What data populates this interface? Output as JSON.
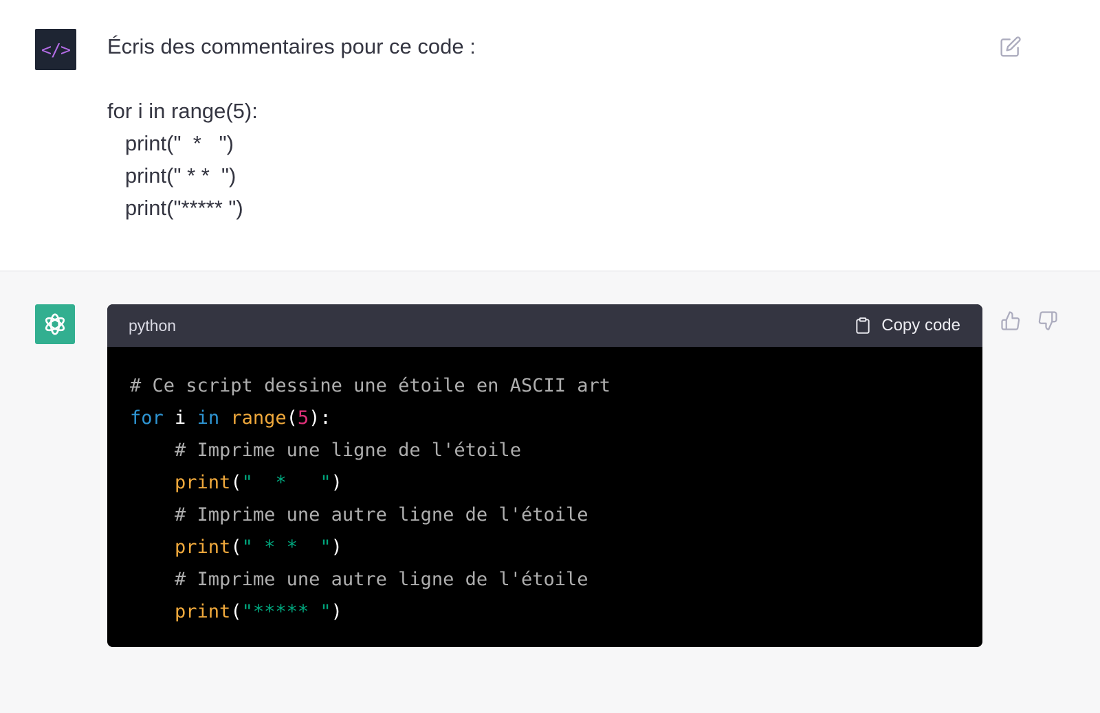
{
  "user": {
    "avatar_glyph": "</>",
    "message": "Écris des commentaires pour ce code :\n\nfor i in range(5):\n   print(\"  *   \")\n   print(\" * *  \")\n   print(\"***** \")"
  },
  "assistant": {
    "code_language": "python",
    "copy_label": "Copy code",
    "code": {
      "line1_comment": "# Ce script dessine une étoile en ASCII art",
      "for_kw": "for",
      "loop_var": " i ",
      "in_kw": "in",
      "range_fn": "range",
      "open_paren": "(",
      "range_arg": "5",
      "close_colon": "):",
      "indent": "    ",
      "comment2": "# Imprime une ligne de l'étoile",
      "print_fn": "print",
      "print_open": "(",
      "str1": "\"  *   \"",
      "print_close": ")",
      "comment3": "# Imprime une autre ligne de l'étoile",
      "str2": "\" * *  \"",
      "comment4": "# Imprime une autre ligne de l'étoile",
      "str3": "\"***** \""
    }
  },
  "colors": {
    "code_bg": "#000000",
    "code_header_bg": "#343541",
    "comment": "#aeaeae",
    "keyword": "#2e95d3",
    "function": "#f0a93c",
    "number": "#df3079",
    "string": "#00a67d",
    "bot_avatar": "#10a37f",
    "user_avatar": "#1e2533"
  },
  "icons": {
    "user_avatar": "code-brackets-icon",
    "bot_avatar": "openai-logo-icon",
    "edit": "edit-pencil-icon",
    "copy": "clipboard-icon",
    "thumb_up": "thumbs-up-icon",
    "thumb_down": "thumbs-down-icon"
  }
}
